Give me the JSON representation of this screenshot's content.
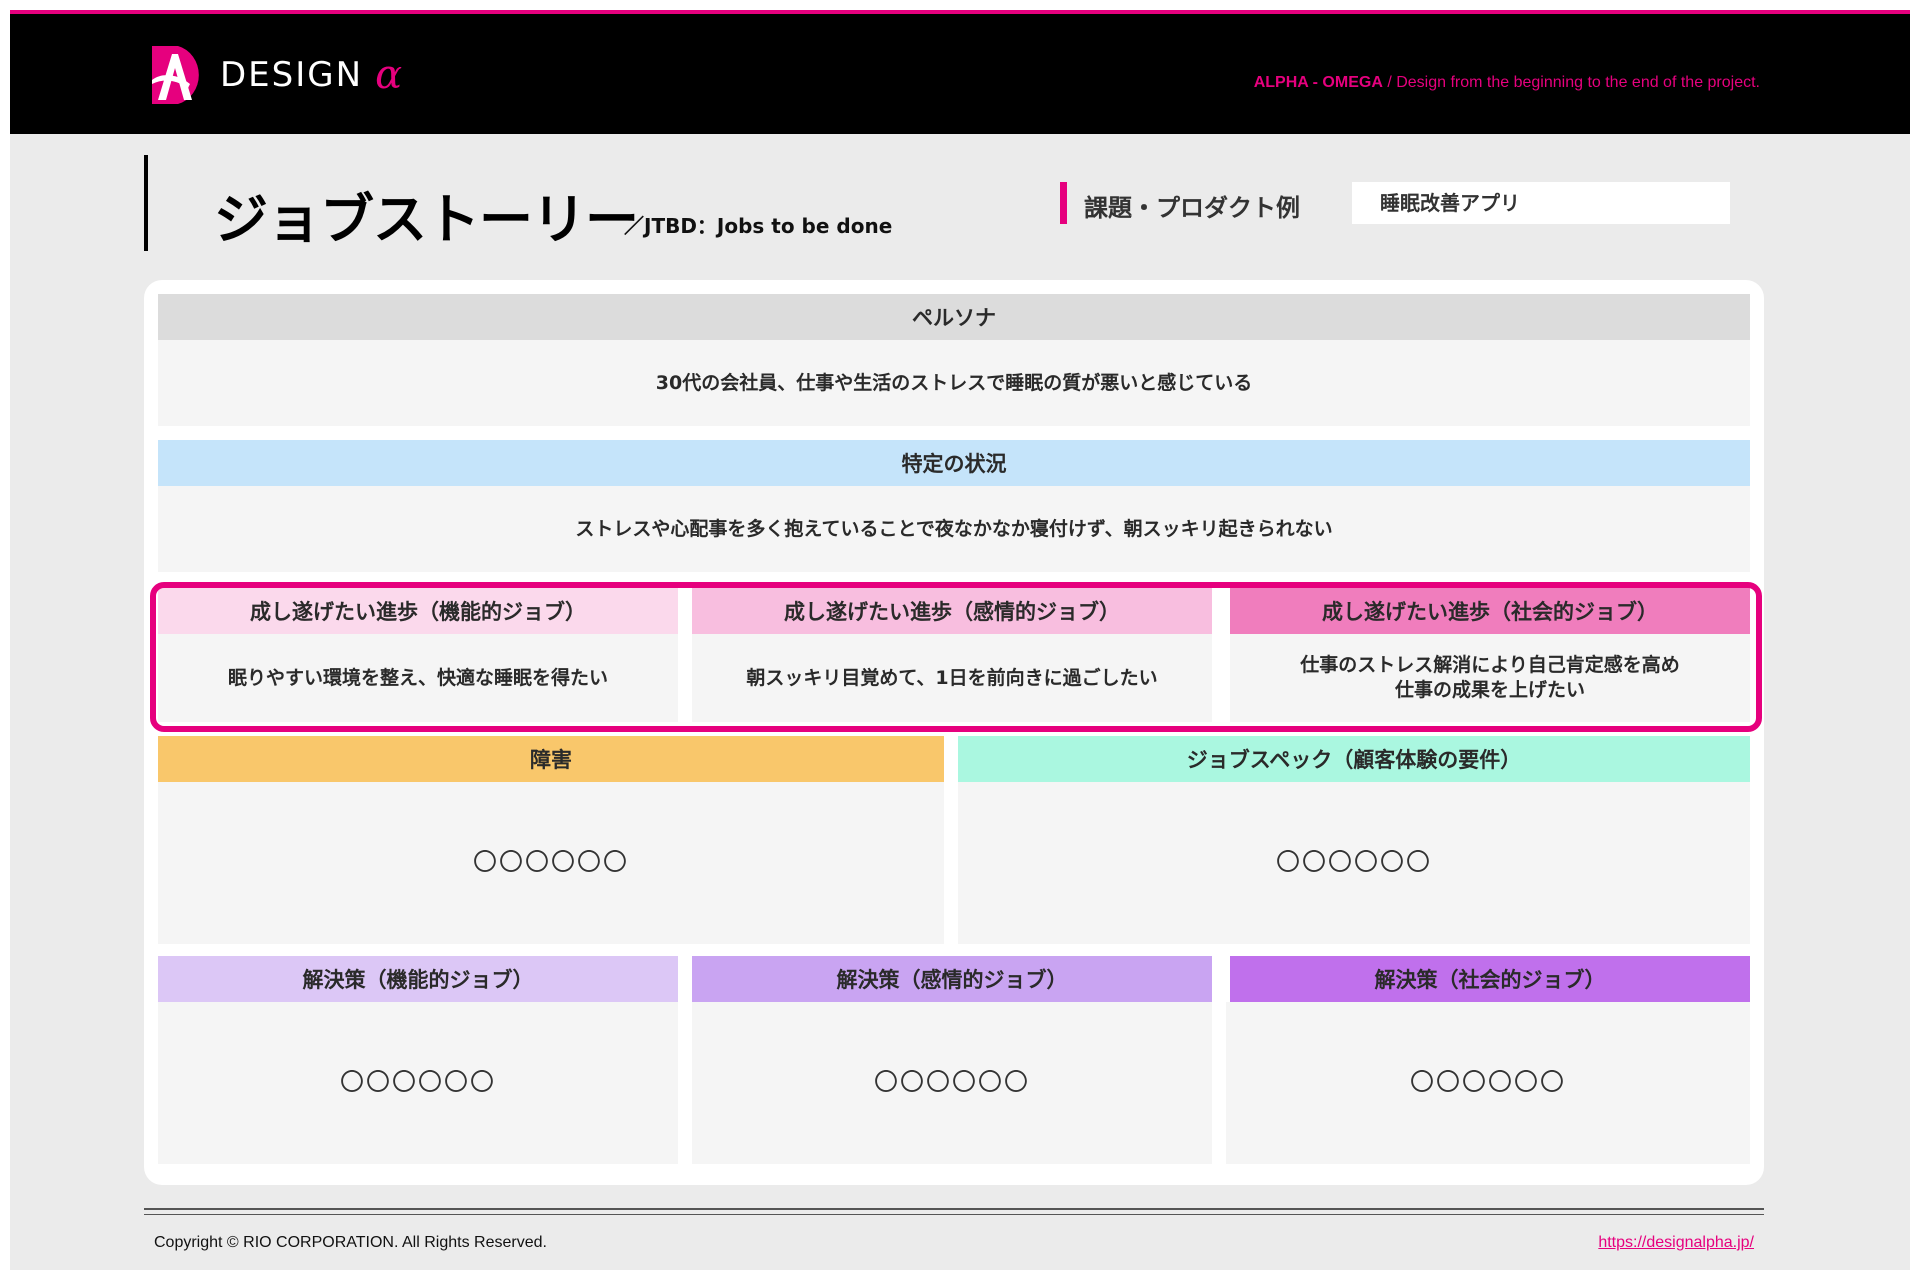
{
  "header": {
    "logo_text": "DESIGN",
    "logo_alpha": "α",
    "tagline_bold": "ALPHA - OMEGA",
    "tagline_rest": " / Design from the beginning to the end of the project.",
    "accent_color": "#e6007e"
  },
  "title": {
    "main": "ジョブストーリー",
    "sub": "／JTBD：Jobs to be done",
    "example_label": "課題・プロダクト例",
    "example_value": "睡眠改善アプリ"
  },
  "persona": {
    "label": "ペルソナ",
    "text": "30代の会社員、仕事や生活のストレスで睡眠の質が悪いと感じている"
  },
  "situation": {
    "label": "特定の状況",
    "text": "ストレスや心配事を多く抱えていることで夜なかなか寝付けず、朝スッキリ起きられない"
  },
  "progress": [
    {
      "label": "成し遂げたい進歩（機能的ジョブ）",
      "text": "眠りやすい環境を整え、快適な睡眠を得たい",
      "color": "#fbd9ec"
    },
    {
      "label": "成し遂げたい進歩（感情的ジョブ）",
      "text": "朝スッキリ目覚めて、1日を前向きに過ごしたい",
      "color": "#f8bedf"
    },
    {
      "label": "成し遂げたい進歩（社会的ジョブ）",
      "text": "仕事のストレス解消により自己肯定感を高め\n仕事の成果を上げたい",
      "color": "#f07dbd"
    }
  ],
  "obstacle": {
    "label": "障害",
    "text": "〇〇〇〇〇〇",
    "color": "#f9c76b"
  },
  "spec": {
    "label": "ジョブスペック（顧客体験の要件）",
    "text": "〇〇〇〇〇〇",
    "color": "#aaf7e0"
  },
  "solutions": [
    {
      "label": "解決策（機能的ジョブ）",
      "text": "〇〇〇〇〇〇",
      "color": "#dcc7f6"
    },
    {
      "label": "解決策（感情的ジョブ）",
      "text": "〇〇〇〇〇〇",
      "color": "#c9a4f2"
    },
    {
      "label": "解決策（社会的ジョブ）",
      "text": "〇〇〇〇〇〇",
      "color": "#c070ec"
    }
  ],
  "footer": {
    "copyright": "Copyright © RIO CORPORATION. All Rights Reserved.",
    "link": "https://designalpha.jp/"
  }
}
